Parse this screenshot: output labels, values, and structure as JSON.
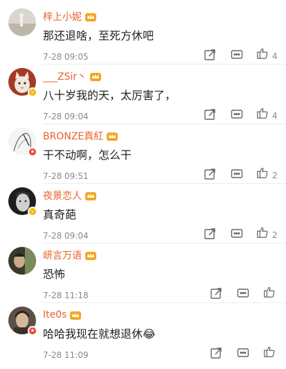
{
  "colors": {
    "username": "#e8612c",
    "text": "#222222",
    "meta": "#888888",
    "crown": "#f5a623",
    "verified_gold": "#f5b301",
    "verified_red": "#e8412c"
  },
  "comments": [
    {
      "user": "梓上小妮",
      "text": "那还退啥，至死方休吧",
      "time": "7-28 09:05",
      "likes": "4",
      "badge": "none",
      "avatar_icon": "avatar-landscape"
    },
    {
      "user": "___ZSir丶",
      "text": "八十岁我的天，太厉害了，",
      "time": "7-28 09:04",
      "likes": "4",
      "badge": "gold",
      "avatar_icon": "avatar-cat"
    },
    {
      "user": "BRONZE真紅",
      "text": "干不动啊，怎么干",
      "time": "7-28 09:51",
      "likes": "2",
      "badge": "red",
      "avatar_icon": "avatar-sketch"
    },
    {
      "user": "夜景恋人",
      "text": "真奇葩",
      "time": "7-28 09:04",
      "likes": "2",
      "badge": "gold",
      "avatar_icon": "avatar-face"
    },
    {
      "user": "岍言万语",
      "text": "恐怖",
      "time": "7-28 11:18",
      "likes": "",
      "badge": "none",
      "avatar_icon": "avatar-photo"
    },
    {
      "user": "Ite0s",
      "text": "哈哈我现在就想退休😂",
      "time": "7-28 11:09",
      "likes": "",
      "badge": "red",
      "avatar_icon": "avatar-portrait"
    }
  ]
}
